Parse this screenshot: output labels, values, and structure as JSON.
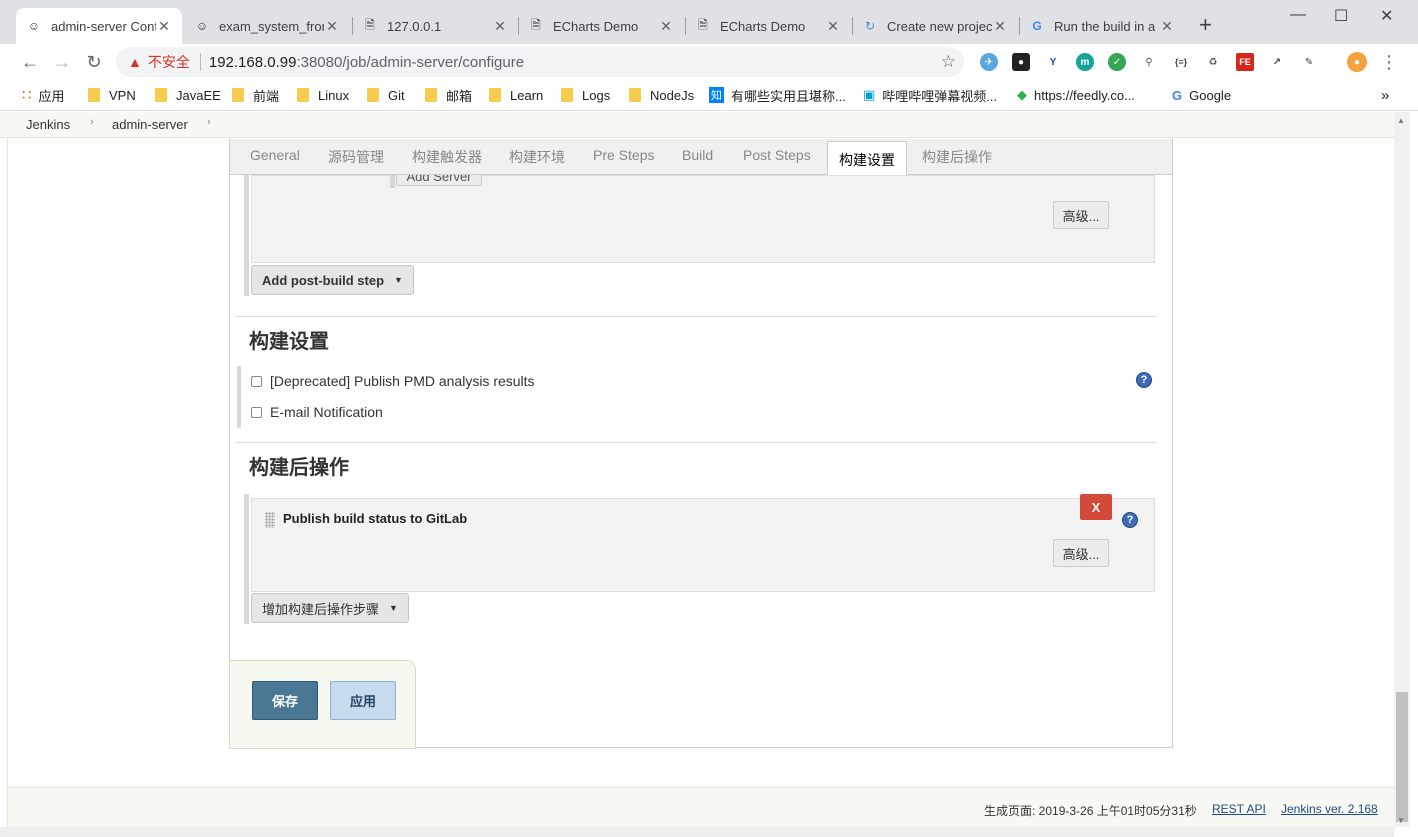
{
  "browser": {
    "tabs": [
      {
        "title": "admin-server Config",
        "icon": "jenkins"
      },
      {
        "title": "exam_system_front",
        "icon": "jenkins"
      },
      {
        "title": "127.0.0.1",
        "icon": "page"
      },
      {
        "title": "ECharts Demo",
        "icon": "page"
      },
      {
        "title": "ECharts Demo",
        "icon": "page"
      },
      {
        "title": "Create new project",
        "icon": "gitlab"
      },
      {
        "title": "Run the build in a",
        "icon": "google"
      }
    ],
    "url": {
      "security_label": "不安全",
      "host": "192.168.0.99",
      "path": ":38080/job/admin-server/configure"
    },
    "bookmarks": [
      {
        "label": "应用",
        "icon": "apps-icon"
      },
      {
        "label": "VPN",
        "icon": "folder-icon"
      },
      {
        "label": "JavaEE",
        "icon": "folder-icon"
      },
      {
        "label": "前端",
        "icon": "folder-icon"
      },
      {
        "label": "Linux",
        "icon": "folder-icon"
      },
      {
        "label": "Git",
        "icon": "folder-icon"
      },
      {
        "label": "邮箱",
        "icon": "folder-icon"
      },
      {
        "label": "Learn",
        "icon": "folder-icon"
      },
      {
        "label": "Logs",
        "icon": "folder-icon"
      },
      {
        "label": "NodeJs",
        "icon": "folder-icon"
      },
      {
        "label": "有哪些实用且堪称...",
        "icon": "zhihu-icon"
      },
      {
        "label": "哔哩哔哩弹幕视频...",
        "icon": "bilibili-icon"
      },
      {
        "label": "https://feedly.co...",
        "icon": "feedly-icon"
      },
      {
        "label": "Google",
        "icon": "google-icon"
      }
    ],
    "overflow": "»"
  },
  "breadcrumbs": [
    "Jenkins",
    "admin-server"
  ],
  "config_tabs": [
    "General",
    "源码管理",
    "构建触发器",
    "构建环境",
    "Pre Steps",
    "Build",
    "Post Steps",
    "构建设置",
    "构建后操作"
  ],
  "active_tab": "构建设置",
  "post_steps": {
    "advanced_label": "高级...",
    "add_step_label": "Add post-build step",
    "clipped_label": "Add Server"
  },
  "build_settings": {
    "title": "构建设置",
    "options": [
      {
        "label": "[Deprecated] Publish PMD analysis results",
        "checked": false
      },
      {
        "label": "E-mail Notification",
        "checked": false
      }
    ]
  },
  "post_build": {
    "title": "构建后操作",
    "action_title": "Publish build status to GitLab",
    "delete_label": "X",
    "advanced_label": "高级...",
    "add_action_label": "增加构建后操作步骤"
  },
  "buttons": {
    "save": "保存",
    "apply": "应用"
  },
  "footer": {
    "generated": "生成页面: 2019-3-26 上午01时05分31秒",
    "rest_api": "REST API",
    "version": "Jenkins ver. 2.168"
  },
  "help_glyph": "?",
  "colors": {
    "save_button": "#4a7794",
    "apply_button": "#c6dbee",
    "delete_button": "#d24939",
    "help_icon": "#3f6cb5",
    "insecure_warning": "#d93025"
  }
}
